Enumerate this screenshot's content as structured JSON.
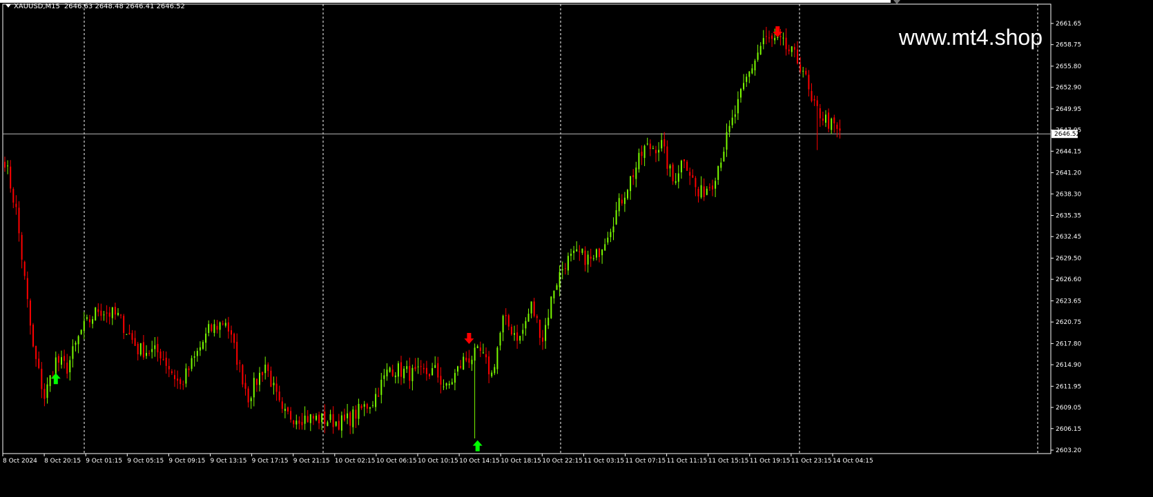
{
  "header": {
    "symbol": "XAUUSD,M15",
    "ohlc": "2646.63 2648.48 2646.41 2646.52"
  },
  "watermark": "www.mt4.shop",
  "price_axis": {
    "labels": [
      "2661.65",
      "2658.75",
      "2655.80",
      "2652.90",
      "2649.95",
      "2647.05",
      "2644.15",
      "2641.20",
      "2638.30",
      "2635.35",
      "2632.45",
      "2629.50",
      "2626.60",
      "2623.65",
      "2620.75",
      "2617.80",
      "2614.90",
      "2611.95",
      "2609.05",
      "2606.15",
      "2603.20"
    ],
    "current_price": "2646.52"
  },
  "time_axis": {
    "labels": [
      "8 Oct 2024",
      "8 Oct 20:15",
      "9 Oct 01:15",
      "9 Oct 05:15",
      "9 Oct 09:15",
      "9 Oct 13:15",
      "9 Oct 17:15",
      "9 Oct 21:15",
      "10 Oct 02:15",
      "10 Oct 06:15",
      "10 Oct 10:15",
      "10 Oct 14:15",
      "10 Oct 18:15",
      "10 Oct 22:15",
      "11 Oct 03:15",
      "11 Oct 07:15",
      "11 Oct 11:15",
      "11 Oct 15:15",
      "11 Oct 19:15",
      "11 Oct 23:15",
      "14 Oct 04:15"
    ]
  },
  "colors": {
    "background": "#000000",
    "bull": "#7CFC00",
    "bear": "#FF0000",
    "grid": "#FFFFFF",
    "arrow_up": "#00FF00",
    "arrow_down": "#FF0000"
  },
  "chart_data": {
    "type": "candlestick",
    "symbol": "XAUUSD",
    "timeframe": "M15",
    "ylim": [
      2603.2,
      2661.65
    ],
    "current_price": 2646.52,
    "keypoints": [
      [
        0,
        2643.0
      ],
      [
        4,
        2636.0
      ],
      [
        10,
        2617.0
      ],
      [
        14,
        2610.5
      ],
      [
        18,
        2615.5
      ],
      [
        22,
        2614.5
      ],
      [
        27,
        2619.5
      ],
      [
        33,
        2622.5
      ],
      [
        40,
        2621.5
      ],
      [
        47,
        2617.0
      ],
      [
        55,
        2616.5
      ],
      [
        62,
        2612.0
      ],
      [
        72,
        2619.5
      ],
      [
        78,
        2621.0
      ],
      [
        86,
        2610.5
      ],
      [
        92,
        2615.0
      ],
      [
        98,
        2608.0
      ],
      [
        110,
        2607.5
      ],
      [
        120,
        2607.0
      ],
      [
        130,
        2610.0
      ],
      [
        136,
        2614.5
      ],
      [
        145,
        2613.5
      ],
      [
        152,
        2614.0
      ],
      [
        156,
        2611.5
      ],
      [
        162,
        2615.5
      ],
      [
        168,
        2616.5
      ],
      [
        172,
        2613.5
      ],
      [
        176,
        2621.0
      ],
      [
        182,
        2618.5
      ],
      [
        186,
        2623.0
      ],
      [
        190,
        2618.5
      ],
      [
        194,
        2625.5
      ],
      [
        198,
        2629.0
      ],
      [
        203,
        2630.0
      ],
      [
        208,
        2629.0
      ],
      [
        214,
        2634.0
      ],
      [
        220,
        2639.5
      ],
      [
        226,
        2644.5
      ],
      [
        232,
        2645.0
      ],
      [
        236,
        2640.0
      ],
      [
        240,
        2643.5
      ],
      [
        245,
        2638.0
      ],
      [
        250,
        2640.0
      ],
      [
        256,
        2647.0
      ],
      [
        262,
        2654.0
      ],
      [
        268,
        2659.5
      ],
      [
        274,
        2659.0
      ],
      [
        278,
        2657.5
      ],
      [
        282,
        2655.5
      ],
      [
        285,
        2650.5
      ],
      [
        290,
        2648.5
      ],
      [
        295,
        2646.5
      ]
    ],
    "spikes": [
      {
        "index": 166,
        "low": 2604.8
      },
      {
        "index": 287,
        "low": 2644.3
      }
    ],
    "signals": [
      {
        "type": "buy",
        "index": 18,
        "price": 2613.0
      },
      {
        "type": "sell",
        "index": 164,
        "price": 2618.5
      },
      {
        "type": "buy",
        "index": 167,
        "price": 2603.8
      },
      {
        "type": "sell",
        "index": 273,
        "price": 2660.5
      }
    ]
  }
}
